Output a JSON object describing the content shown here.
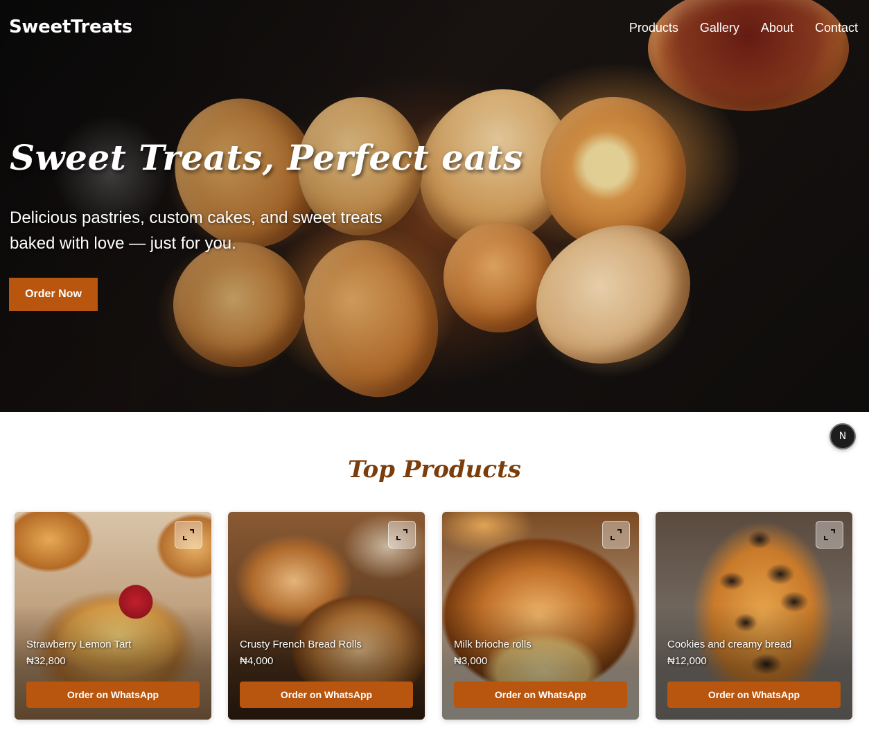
{
  "header": {
    "brand": "SweetTreats",
    "nav": [
      "Products",
      "Gallery",
      "About",
      "Contact"
    ]
  },
  "hero": {
    "title": "Sweet Treats, Perfect eats",
    "subtitle": "Delicious pastries, custom cakes, and sweet treats baked with love — just for you.",
    "cta_label": "Order Now"
  },
  "fab": {
    "label": "N"
  },
  "products_section": {
    "title": "Top Products",
    "items": [
      {
        "name": "Strawberry Lemon Tart",
        "price": "₦32,800",
        "button": "Order on WhatsApp"
      },
      {
        "name": "Crusty French Bread Rolls",
        "price": "₦4,000",
        "button": "Order on WhatsApp"
      },
      {
        "name": "Milk brioche rolls",
        "price": "₦3,000",
        "button": "Order on WhatsApp"
      },
      {
        "name": "Cookies and creamy bread",
        "price": "₦12,000",
        "button": "Order on WhatsApp"
      }
    ]
  },
  "colors": {
    "accent": "#b8560f",
    "section_title": "#7a3d0b"
  },
  "icons": {
    "expand": "expand-icon"
  }
}
